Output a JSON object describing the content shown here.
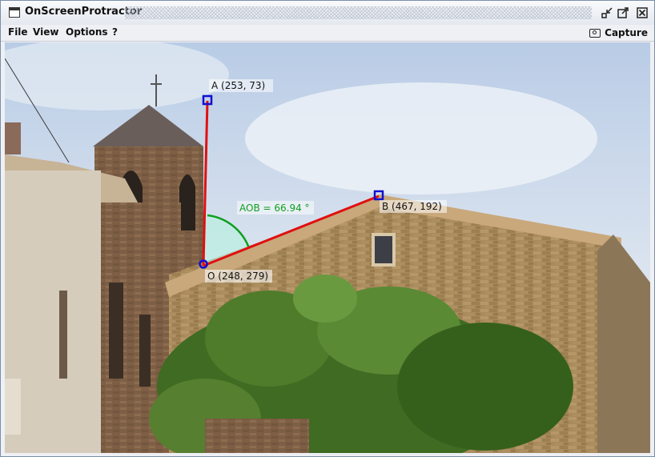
{
  "window": {
    "title": "OnScreenProtractor"
  },
  "menu": {
    "file": "File",
    "view": "View",
    "options": "Options",
    "help": "?"
  },
  "toolbar": {
    "capture_label": "Capture"
  },
  "icons": {
    "app": "window-icon",
    "minimize": "minimize-icon",
    "maximize": "maximize-icon",
    "close": "close-icon",
    "capture": "camera-icon"
  },
  "protractor": {
    "point_a_label": "A (253, 73)",
    "point_b_label": "B (467, 192)",
    "origin_label": "O (248, 279)",
    "angle_label": "AOB = 66.94 °",
    "line_color": "#e01010",
    "handle_color": "#1010d0",
    "angle_color": "#10a020"
  }
}
